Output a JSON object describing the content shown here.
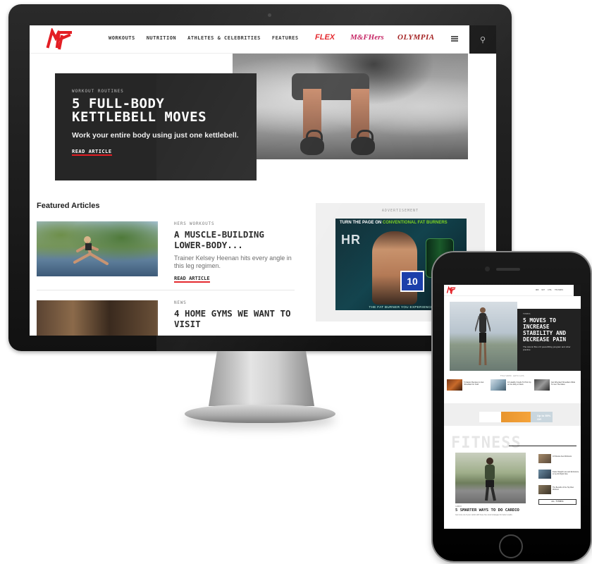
{
  "desktop": {
    "logo_alt": "M&F",
    "nav": {
      "links": [
        "WORKOUTS",
        "NUTRITION",
        "ATHLETES & CELEBRITIES",
        "FEATURES"
      ],
      "brand_flex": "FLEX",
      "brand_mfh": "M&FHers",
      "brand_olympia": "OLYMPIA"
    },
    "hero": {
      "kicker": "WORKOUT ROUTINES",
      "title": "5 FULL-BODY KETTLEBELL MOVES",
      "subtitle": "Work your entire body using just one kettlebell.",
      "cta": "READ ARTICLE"
    },
    "featured": {
      "heading": "Featured Articles",
      "items": [
        {
          "kicker": "HERS WORKOUTS",
          "title": "A MUSCLE-BUILDING LOWER-BODY...",
          "subtitle": "Trainer Kelsey Heenan hits every angle in this leg regimen.",
          "cta": "READ ARTICLE"
        },
        {
          "kicker": "NEWS",
          "title": "4 HOME GYMS WE WANT TO VISIT"
        }
      ]
    },
    "ad": {
      "label": "ADVERTISEMENT",
      "headline_pre": "TURN THE PAGE ON",
      "headline_em": "CONVENTIONAL FAT BURNERS",
      "brand": "HR",
      "badge": "10",
      "footer": "THE FAT BURNER YOU EXPERIENCE"
    }
  },
  "phone": {
    "nav_links": [
      "WRK",
      "NUT",
      "ATHL",
      "FEATURES"
    ],
    "hero": {
      "kicker": "FITNESS",
      "title": "5 MOVES TO INCREASE STABILITY AND DECREASE PAIN",
      "subtitle": "The Atomic Box 2.0 powerlifting program and other practice"
    },
    "featured_label": "FEATURED ARTICLES",
    "featured": [
      "5 Classic Recipes to Get Shredded for Cold",
      "10 Healthy Foods To Pick Up on the Way to Work",
      "Get Wrecked Shoulders Wide To Get The Mass"
    ],
    "ad_text": "Up to 55% Off",
    "section": "FITNESS",
    "section_article": {
      "kicker": "CARDIO",
      "title": "5 SMARTER WAYS TO DO CARDIO",
      "subtitle": "Get more out of your cardio with these five smart strategies for better results."
    },
    "side_items": [
      "10 Muscle-Fuel Workouts",
      "Faster Weight Loss and Endurance to Get Fit Right Now",
      "The Benefits of the Top Row Workout"
    ],
    "all_button": "ALL FITNESS"
  },
  "colors": {
    "brand_red": "#e31e24",
    "dark_box": "#262626",
    "hers_pink": "#c2185b"
  }
}
